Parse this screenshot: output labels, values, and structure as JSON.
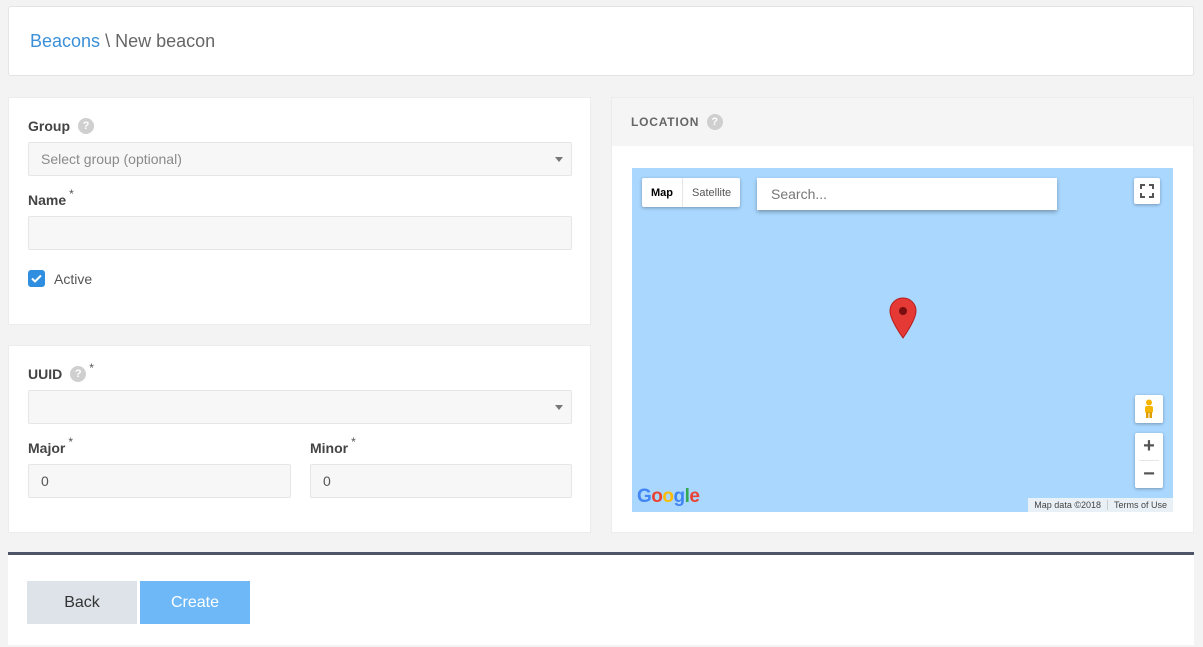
{
  "breadcrumb": {
    "parent": "Beacons",
    "separator": "\\",
    "current": "New beacon"
  },
  "form": {
    "group_label": "Group",
    "group_placeholder": "Select group (optional)",
    "name_label": "Name",
    "required_mark": "*",
    "help_mark": "?",
    "active_label": "Active",
    "active_checked": true,
    "uuid_label": "UUID",
    "major_label": "Major",
    "major_value": "0",
    "minor_label": "Minor",
    "minor_value": "0"
  },
  "location": {
    "title": "LOCATION",
    "map_tab": "Map",
    "satellite_tab": "Satellite",
    "search_placeholder": "Search...",
    "logo": "Google",
    "map_data": "Map data ©2018",
    "terms": "Terms of Use",
    "zoom_in": "+",
    "zoom_out": "−"
  },
  "actions": {
    "back": "Back",
    "create": "Create"
  },
  "colors": {
    "accent": "#3a8fd8",
    "map_water": "#a9d7fe",
    "create_button": "#6fb8f7",
    "pin": "#e53935"
  }
}
